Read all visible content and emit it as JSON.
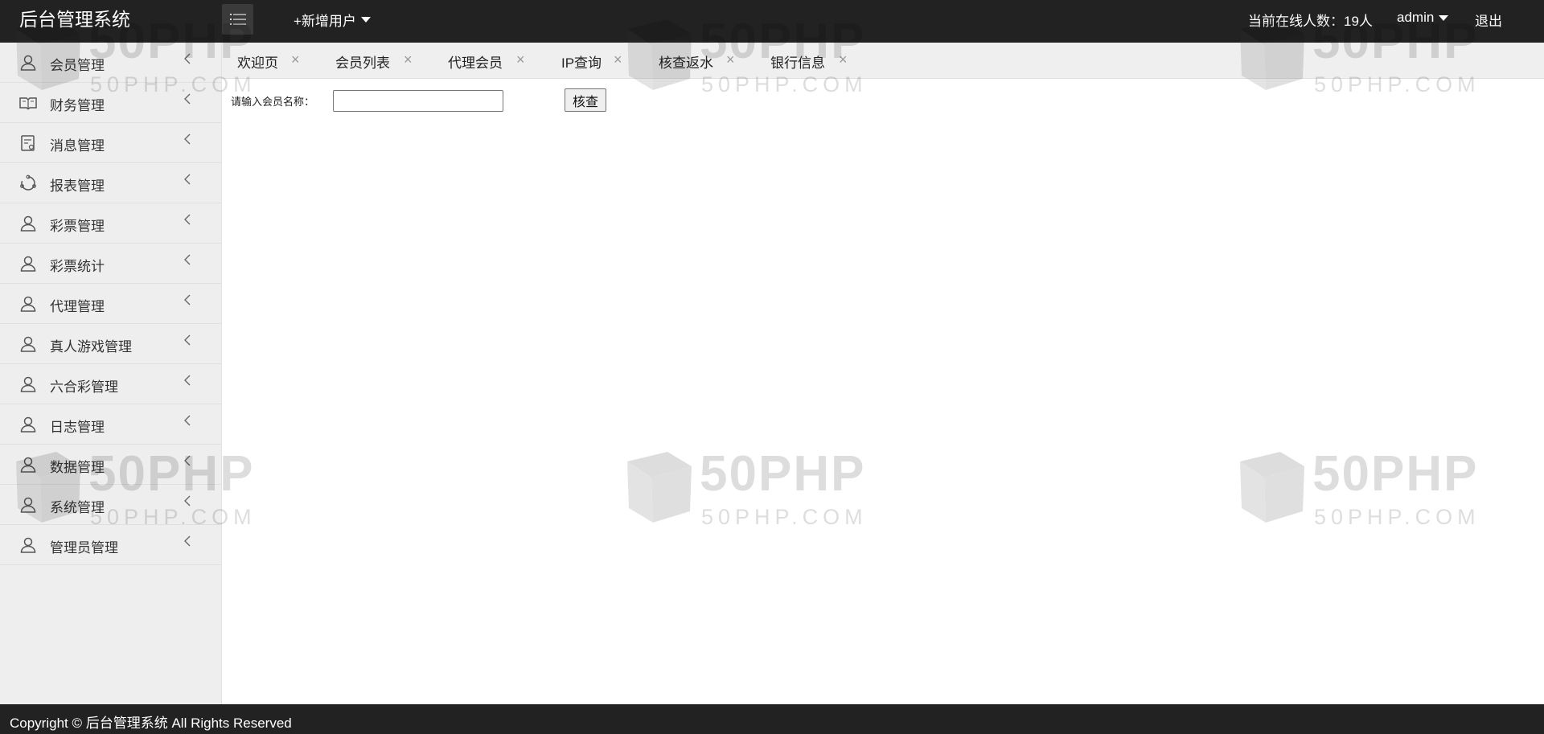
{
  "header": {
    "app_title": "后台管理系统",
    "add_user_label": "+新增用户",
    "online_label": "当前在线人数：19人",
    "admin_label": "admin",
    "logout_label": "退出"
  },
  "sidebar": {
    "items": [
      {
        "label": "会员管理",
        "icon": "user-icon"
      },
      {
        "label": "财务管理",
        "icon": "book-icon"
      },
      {
        "label": "消息管理",
        "icon": "message-icon"
      },
      {
        "label": "报表管理",
        "icon": "report-icon"
      },
      {
        "label": "彩票管理",
        "icon": "user-icon"
      },
      {
        "label": "彩票统计",
        "icon": "user-icon"
      },
      {
        "label": "代理管理",
        "icon": "user-icon"
      },
      {
        "label": "真人游戏管理",
        "icon": "user-icon"
      },
      {
        "label": "六合彩管理",
        "icon": "user-icon"
      },
      {
        "label": "日志管理",
        "icon": "user-icon"
      },
      {
        "label": "数据管理",
        "icon": "user-icon"
      },
      {
        "label": "系统管理",
        "icon": "user-icon"
      },
      {
        "label": "管理员管理",
        "icon": "user-icon"
      }
    ]
  },
  "tabs": [
    {
      "label": "欢迎页"
    },
    {
      "label": "会员列表"
    },
    {
      "label": "代理会员"
    },
    {
      "label": "IP查询"
    },
    {
      "label": "核查返水"
    },
    {
      "label": "银行信息"
    }
  ],
  "query": {
    "label": "请输入会员名称：",
    "value": "",
    "button_label": "核查"
  },
  "footer": {
    "copyright": "Copyright © 后台管理系统 All Rights Reserved"
  },
  "watermark": {
    "big": "50PHP",
    "small": "50PHP.COM"
  }
}
